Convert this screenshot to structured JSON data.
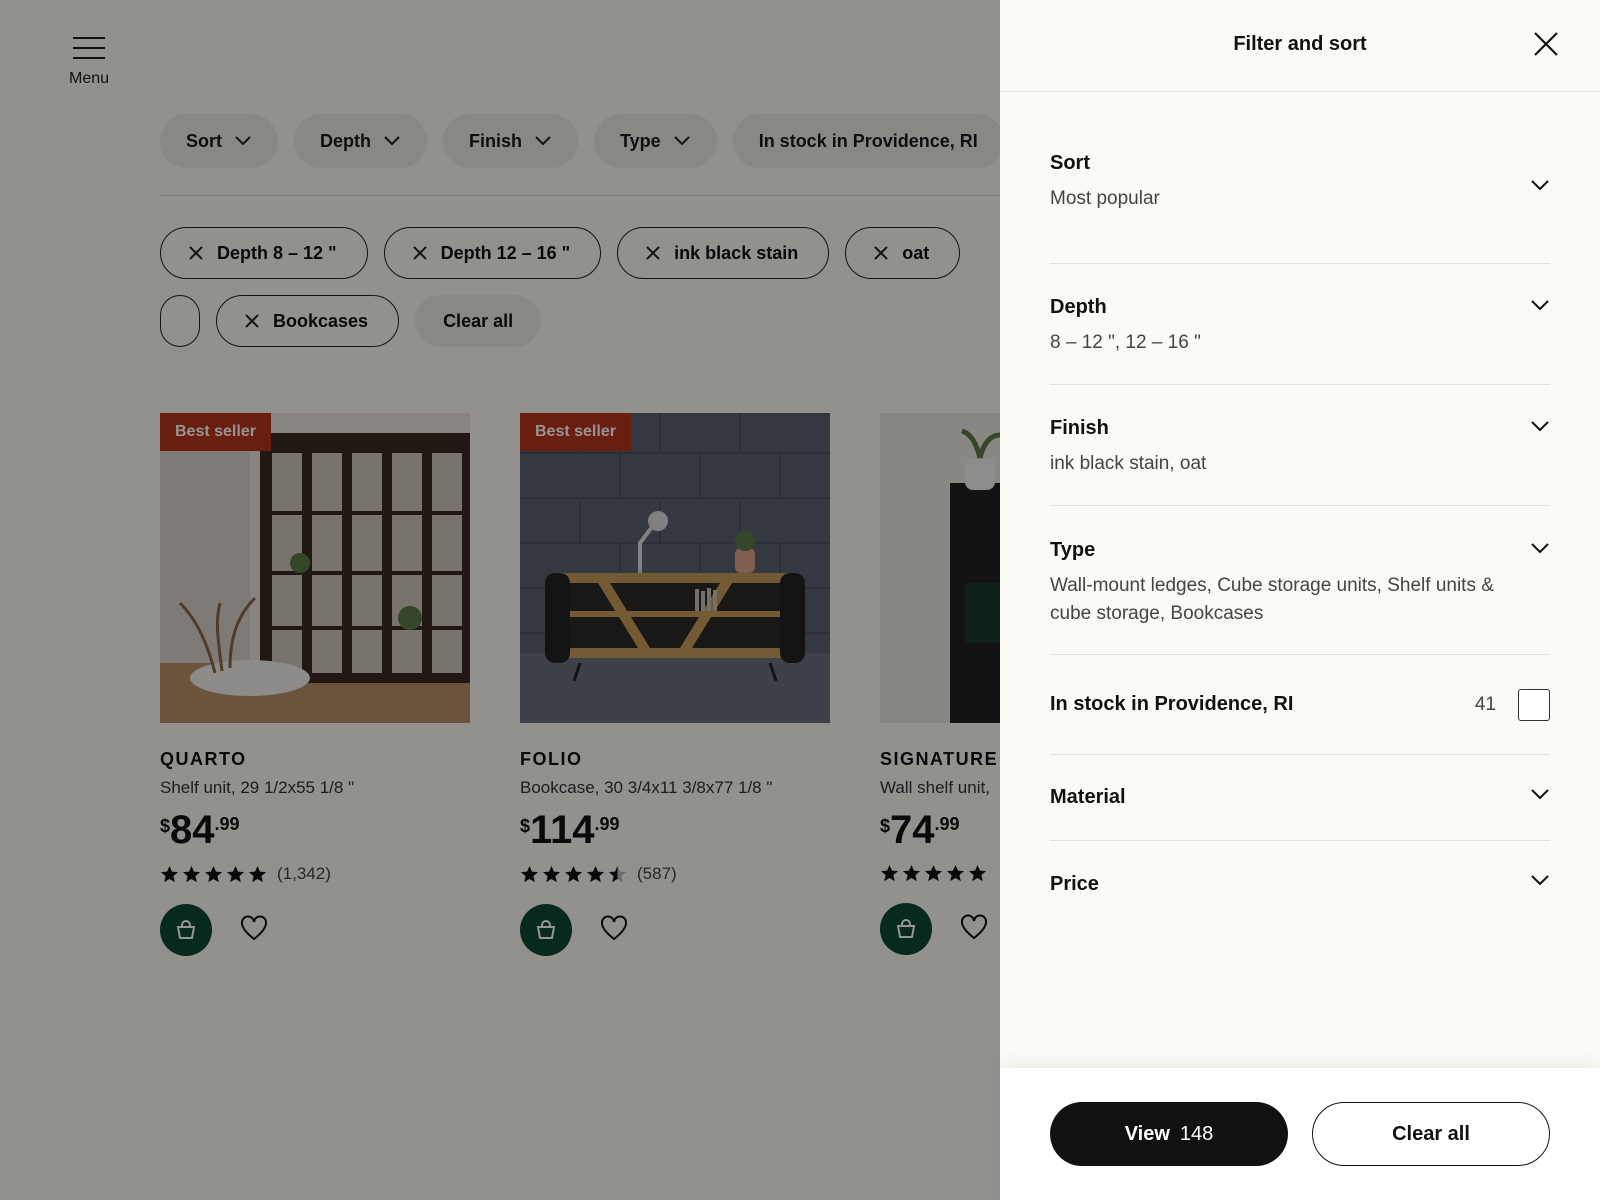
{
  "header": {
    "menu_label": "Menu"
  },
  "filter_pills": [
    {
      "label": "Sort"
    },
    {
      "label": "Depth"
    },
    {
      "label": "Finish"
    },
    {
      "label": "Type"
    },
    {
      "label": "In stock in Providence, RI"
    }
  ],
  "active_chips": [
    {
      "label": "Depth 8 – 12 \""
    },
    {
      "label": "Depth 12 – 16 \""
    },
    {
      "label": "ink black stain"
    },
    {
      "label": "oat"
    },
    {
      "label": ""
    },
    {
      "label": "Bookcases"
    }
  ],
  "clear_chips_label": "Clear all",
  "products": [
    {
      "badge": "Best seller",
      "brand": "QUARTO",
      "desc": "Shelf unit, 29 1/2x55 1/8 \"",
      "currency": "$",
      "price_int": "84",
      "price_dec": ".99",
      "rating": 5,
      "reviews": "(1,342)"
    },
    {
      "badge": "Best seller",
      "brand": "FOLIO",
      "desc": "Bookcase, 30 3/4x11 3/8x77 1/8 \"",
      "currency": "$",
      "price_int": "114",
      "price_dec": ".99",
      "rating": 4.5,
      "reviews": "(587)"
    },
    {
      "badge": "",
      "brand": "SIGNATURE",
      "desc": "Wall shelf unit,",
      "currency": "$",
      "price_int": "74",
      "price_dec": ".99",
      "rating": 5,
      "reviews": ""
    }
  ],
  "drawer": {
    "title": "Filter and sort",
    "sections": [
      {
        "title": "Sort",
        "value": "Most popular"
      },
      {
        "title": "Depth",
        "value": "8 – 12 \", 12 – 16 \""
      },
      {
        "title": "Finish",
        "value": "ink black stain, oat"
      },
      {
        "title": "Type",
        "value": "Wall-mount ledges, Cube storage units, Shelf units & cube storage, Bookcases"
      }
    ],
    "stock": {
      "label": "In stock in Providence, RI",
      "count": "41",
      "checked": false
    },
    "collapsed_sections": [
      {
        "title": "Material"
      },
      {
        "title": "Price"
      }
    ],
    "view_label": "View",
    "view_count": "148",
    "clear_label": "Clear all"
  },
  "colors": {
    "badge": "#b7341d",
    "cart_button": "#0f4733",
    "overlay": "#000000"
  }
}
